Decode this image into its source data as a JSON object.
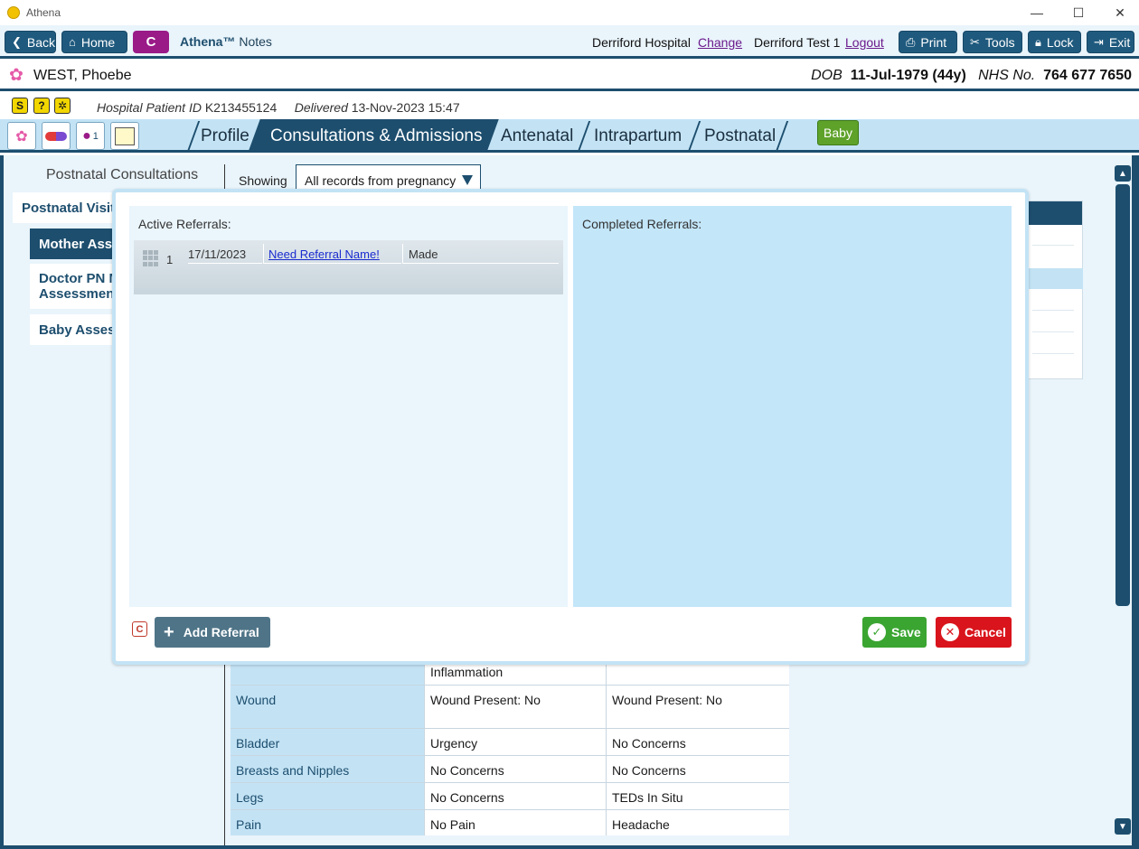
{
  "window": {
    "title": "Athena",
    "minimize": "—",
    "maximize": "☐",
    "close": "✕"
  },
  "toolbar": {
    "back": "Back",
    "home": "Home",
    "c_button": "C",
    "brand_name": "Athena™",
    "brand_suffix": "Notes",
    "hospital": "Derriford Hospital",
    "change": "Change",
    "user": "Derriford Test 1",
    "logout": "Logout",
    "print": "Print",
    "tools": "Tools",
    "lock": "Lock",
    "exit": "Exit"
  },
  "patient": {
    "name": "WEST, Phoebe",
    "dob_label": "DOB",
    "dob": "11-Jul-1979 (44y)",
    "nhs_label": "NHS No.",
    "nhs": "764 677 7650"
  },
  "info": {
    "badges": [
      "S",
      "?",
      "✲"
    ],
    "hospital_id_label": "Hospital Patient ID",
    "hospital_id": "K213455124",
    "delivered_label": "Delivered",
    "delivered": "13-Nov-2023 15:47"
  },
  "tabs": {
    "profile": "Profile",
    "consultations": "Consultations & Admissions",
    "antenatal": "Antenatal",
    "intrapartum": "Intrapartum",
    "postnatal": "Postnatal",
    "baby": "Baby",
    "quick_badge": "1"
  },
  "left": {
    "title": "Postnatal Consultations",
    "visits": "Postnatal Visits",
    "mother": "Mother Asse",
    "doctor_l1": "Doctor PN M",
    "doctor_l2": "Assessments",
    "baby": "Baby Assessr"
  },
  "filter": {
    "label": "Showing",
    "value": "All records from pregnancy"
  },
  "assessment_rows": [
    {
      "label": "",
      "v1": "Inflammation",
      "v2": ""
    },
    {
      "label": "Wound",
      "v1": "Wound Present: No",
      "v2": "Wound Present: No"
    },
    {
      "label": "Bladder",
      "v1": "Urgency",
      "v2": "No Concerns"
    },
    {
      "label": "Breasts and Nipples",
      "v1": "No Concerns",
      "v2": "No Concerns"
    },
    {
      "label": "Legs",
      "v1": "No Concerns",
      "v2": "TEDs In Situ"
    },
    {
      "label": "Pain",
      "v1": "No Pain",
      "v2": "Headache"
    }
  ],
  "modal": {
    "active_label": "Active Referrals:",
    "completed_label": "Completed Referrals:",
    "referral": {
      "num": "1",
      "date": "17/11/2023",
      "name": "Need Referral Name!",
      "status": "Made"
    },
    "c_icon": "C",
    "add": "Add Referral",
    "save": "Save",
    "cancel": "Cancel"
  },
  "colors": {
    "navy": "#1d4e6e",
    "light_blue": "#c3e3f5",
    "save_green": "#3aa531",
    "cancel_red": "#d9141c",
    "c_purple": "#9a1a88",
    "baby_green": "#5fa22a"
  }
}
